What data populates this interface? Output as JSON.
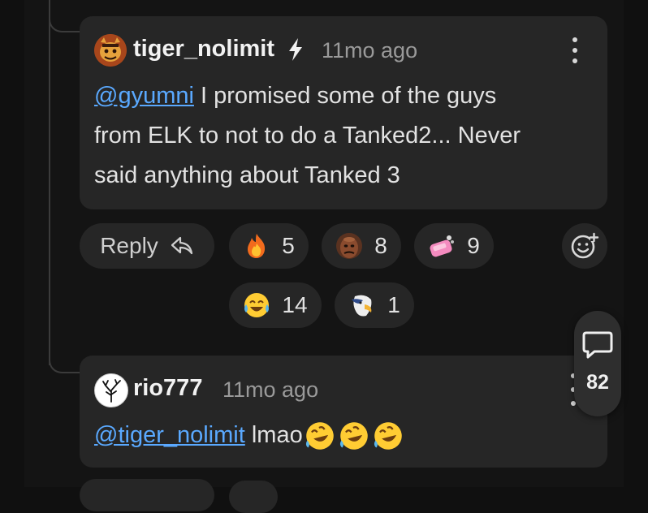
{
  "comment1": {
    "username": "tiger_nolimit",
    "badge_icon": "lightning-bolt-icon",
    "time": "11mo ago",
    "mention": "@gyumni",
    "text_line1": " I promised some of the guys",
    "text_line2": "from ELK to not to do a Tanked2... Never",
    "text_line3": "said anything about Tanked 3",
    "reply_label": "Reply",
    "reactions": [
      {
        "icon": "fire-emoji",
        "count": "5"
      },
      {
        "icon": "bald-man-face-emoji",
        "count": "8"
      },
      {
        "icon": "pink-soap-emoji",
        "count": "9"
      },
      {
        "icon": "tears-of-joy-emoji",
        "count": "14"
      },
      {
        "icon": "bald-eagle-emoji",
        "count": "1"
      }
    ]
  },
  "comment2": {
    "username": "rio777",
    "time": "11mo ago",
    "mention": "@tiger_nolimit",
    "text": " lmao"
  },
  "comments_fab": {
    "count": "82"
  },
  "colors": {
    "background": "#141414",
    "card": "#262626",
    "mention": "#5aa9ff",
    "muted": "#9a9a9a"
  }
}
